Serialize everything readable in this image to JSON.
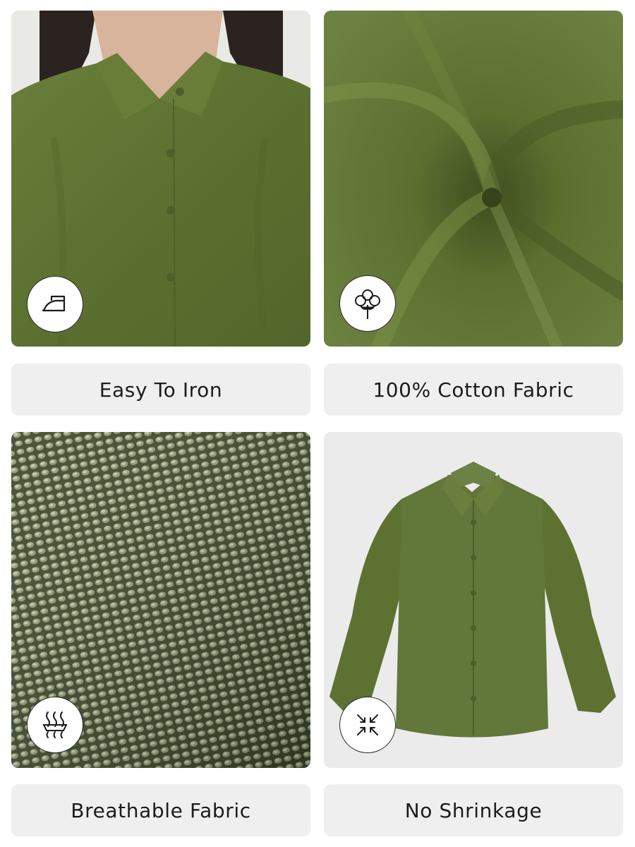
{
  "features": [
    {
      "label": "Easy To Iron",
      "icon": "iron-icon",
      "image": "woman-wearing-olive-shirt-closeup"
    },
    {
      "label": "100% Cotton Fabric",
      "icon": "cotton-flower-icon",
      "image": "twisted-olive-cotton-fabric"
    },
    {
      "label": "Breathable Fabric",
      "icon": "breathable-fabric-icon",
      "image": "fabric-weave-macro"
    },
    {
      "label": "No Shrinkage",
      "icon": "no-shrink-arrows-icon",
      "image": "olive-shirt-flat-lay"
    }
  ],
  "colors": {
    "olive": "#5f7233",
    "olive_dark": "#4a5a26",
    "label_bg": "#efefef",
    "text": "#1c1c1c"
  }
}
